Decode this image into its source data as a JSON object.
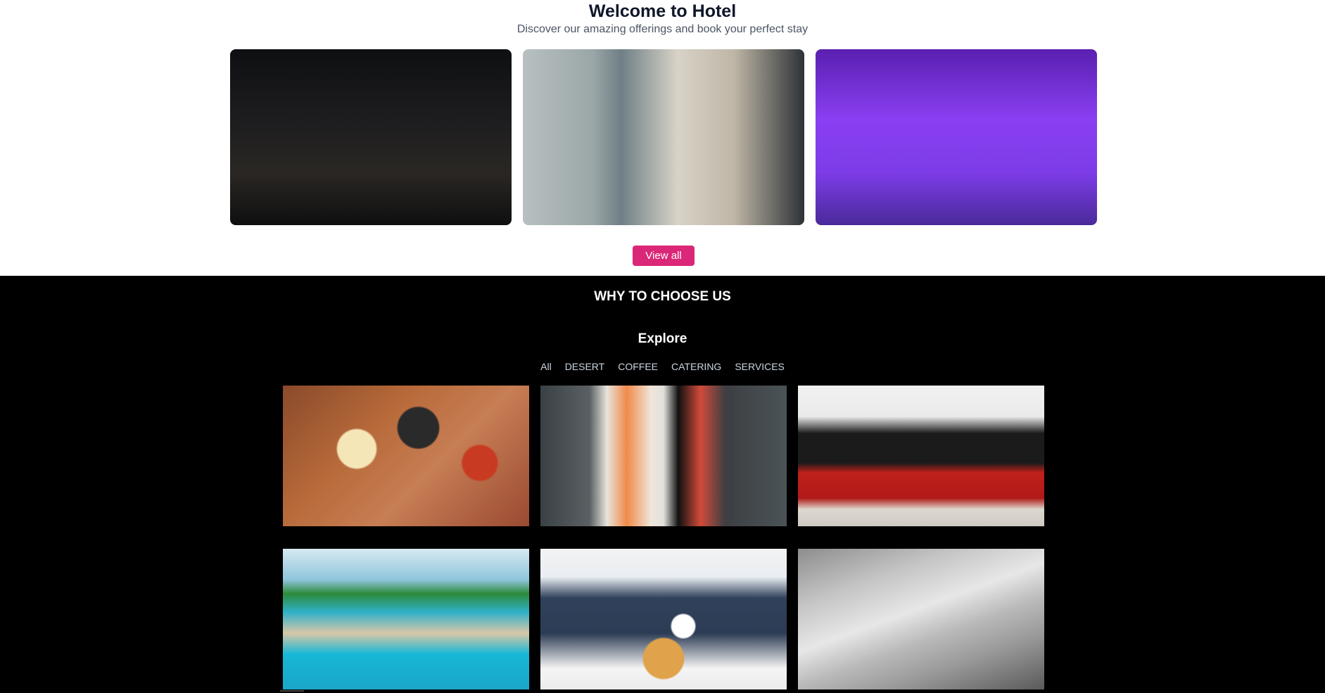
{
  "hero": {
    "title": "Welcome to Hotel",
    "subtitle": "Discover our amazing offerings and book your perfect stay",
    "view_all_label": "View all",
    "rooms": [
      {
        "name": "room-luxury-fireplace"
      },
      {
        "name": "room-bathroom"
      },
      {
        "name": "room-purple-bedroom"
      }
    ],
    "accent_color": "#db2777"
  },
  "why_section": {
    "heading": "WHY TO CHOOSE US",
    "explore_title": "Explore",
    "filters": [
      "All",
      "DESERT",
      "COFFEE",
      "CATERING",
      "SERVICES"
    ],
    "tiles": [
      {
        "name": "gallery-breakfast"
      },
      {
        "name": "gallery-sushi"
      },
      {
        "name": "gallery-bar"
      },
      {
        "name": "gallery-beach-pool"
      },
      {
        "name": "gallery-room-service"
      },
      {
        "name": "gallery-bed-amenities"
      }
    ]
  }
}
